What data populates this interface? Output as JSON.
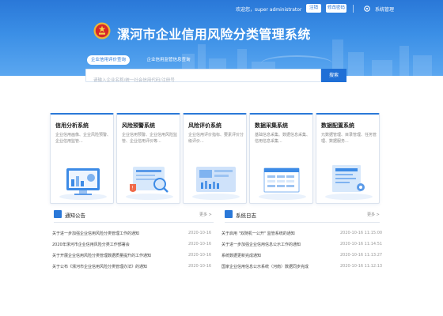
{
  "header": {
    "welcome": "欢迎您，super administrator",
    "login_label": "注销",
    "change_pwd_label": "修改密码",
    "system_label": "系统管理",
    "title": "漯河市企业信用风险分类管理系统"
  },
  "search": {
    "tabs": [
      {
        "label": "企业信用评价查询"
      },
      {
        "label": "企业信用监管信息查询"
      }
    ],
    "placeholder": "请输入企业名称/统一社会信用代码/注册号",
    "button_label": "搜索"
  },
  "cards": [
    {
      "title": "信用分析系统",
      "desc": "企业信用画像、企业风险预警、企业信用监管..."
    },
    {
      "title": "风险预警系统",
      "desc": "企业信用预警、企业信用风险监管、企业信用评价等..."
    },
    {
      "title": "风险评价系统",
      "desc": "企业信用评价指标、要素评价分级评价..."
    },
    {
      "title": "数据采集系统",
      "desc": "基础信息采集、数据信息采集、信用信息采集..."
    },
    {
      "title": "数据配置系统",
      "desc": "元数据管理、目录管理、任务管理、数据服务..."
    }
  ],
  "notices": {
    "title": "通知公告",
    "more": "更多 >",
    "items": [
      {
        "text": "关于进一步加强企业信用风险分类管理工作的通知",
        "date": "2020-10-16"
      },
      {
        "text": "2020年漯河市企业信用风险分类工作部署会",
        "date": "2020-10-16"
      },
      {
        "text": "关于开展企业信用风险分类管理数据质量提升的工作通知",
        "date": "2020-10-16"
      },
      {
        "text": "关于公布《漯河市企业信用风险分类管理办法》的通知",
        "date": "2020-10-16"
      }
    ]
  },
  "logs": {
    "title": "系统日志",
    "more": "更多 >",
    "items": [
      {
        "text": "关于启用 \"双随机一公开\" 监管系统的通知",
        "date": "2020-10-16 11:15:00"
      },
      {
        "text": "关于进一步加强企业信用信息公示工作的通知",
        "date": "2020-10-16 11:14:51"
      },
      {
        "text": "系统数据更新完成通知",
        "date": "2020-10-16 11:13:27"
      },
      {
        "text": "国家企业信用信息公示系统（河南）数据同步完成",
        "date": "2020-10-16 11:12:13"
      }
    ]
  },
  "colors": {
    "primary": "#2a78d8",
    "banner_top": "#2a78d8",
    "banner_bottom": "#5ba7f0",
    "search_button": "#1f6fd6"
  },
  "icons": [
    "gear-icon",
    "emblem-icon",
    "notice-icon",
    "log-icon"
  ]
}
